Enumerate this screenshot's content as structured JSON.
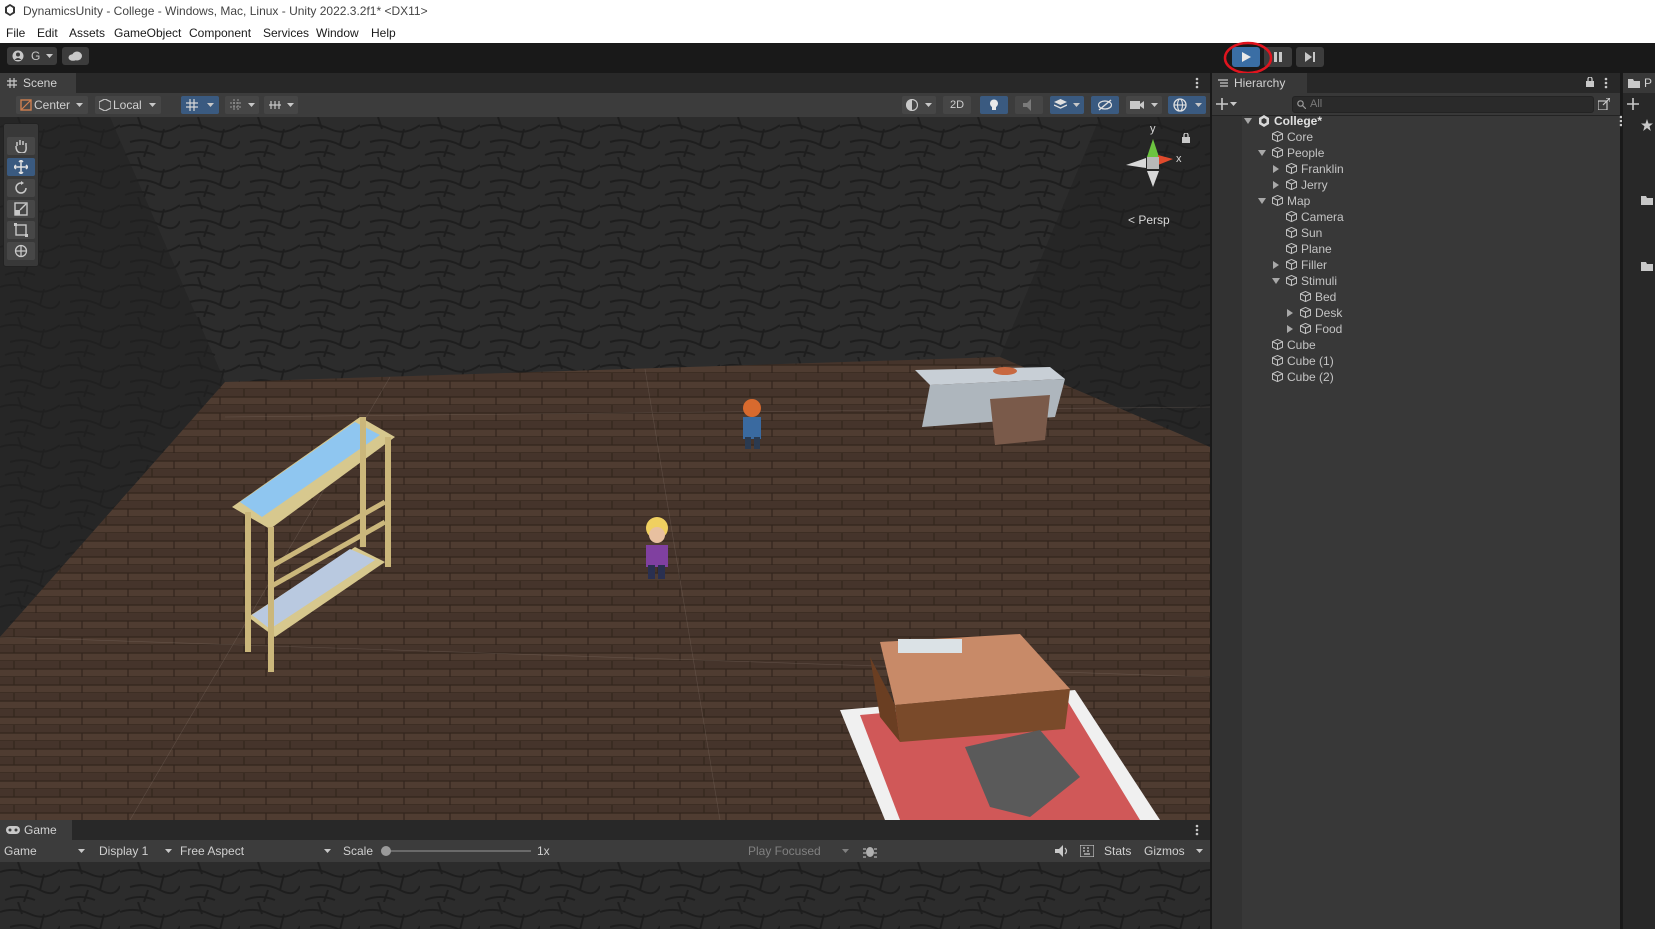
{
  "window": {
    "title": "DynamicsUnity - College - Windows, Mac, Linux - Unity 2022.3.2f1* <DX11>"
  },
  "menu": [
    "File",
    "Edit",
    "Assets",
    "GameObject",
    "Component",
    "Services",
    "Window",
    "Help"
  ],
  "toolbar": {
    "account_label": "G",
    "play_icon": "play-icon",
    "pause_icon": "pause-icon",
    "step_icon": "step-icon"
  },
  "scene": {
    "tab": "Scene",
    "pivot": "Center",
    "space": "Local",
    "mode_2d": "2D",
    "persp": "Persp",
    "gizmo_y": "y",
    "gizmo_x": "x"
  },
  "game": {
    "tab": "Game",
    "view": "Game",
    "display": "Display 1",
    "aspect": "Free Aspect",
    "scale_label": "Scale",
    "scale_value": "1x",
    "play_mode": "Play Focused",
    "stats": "Stats",
    "gizmos": "Gizmos"
  },
  "hierarchy": {
    "tab": "Hierarchy",
    "search_placeholder": "All",
    "root": "College*",
    "items": [
      "Core",
      "People",
      "Franklin",
      "Jerry",
      "Map",
      "Camera",
      "Sun",
      "Plane",
      "Filler",
      "Stimuli",
      "Bed",
      "Desk",
      "Food",
      "Cube",
      "Cube (1)",
      "Cube (2)"
    ]
  },
  "project": {
    "tab": "P"
  },
  "colors": {
    "highlight_ring": "#e0141e",
    "play_active": "#3a6ea5"
  }
}
